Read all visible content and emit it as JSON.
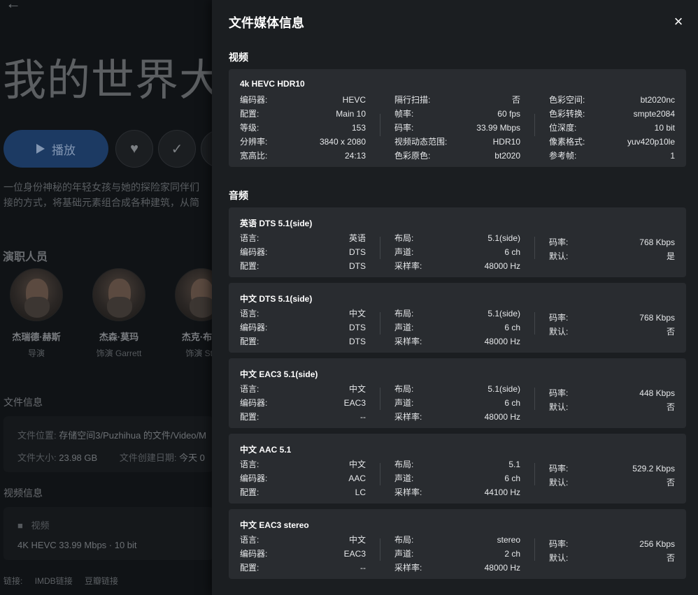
{
  "background": {
    "back_arrow": "←",
    "movie_title": "我的世界大",
    "play_label": "播放",
    "overview_line1": "一位身份神秘的年轻女孩与她的探险家同伴们",
    "overview_line2": "接的方式，将基础元素组合成各种建筑，从简",
    "cast_title": "演职人员",
    "cast": [
      {
        "name": "杰瑞德·赫斯",
        "role": "导演"
      },
      {
        "name": "杰森·莫玛",
        "role": "饰演 Garrett"
      },
      {
        "name": "杰克·布莱",
        "role": "饰演 Ste"
      }
    ],
    "file_info_title": "文件信息",
    "file_location_label": "文件位置:",
    "file_location_value": "存储空间3/Puzhihua 的文件/Video/M",
    "file_size_label": "文件大小:",
    "file_size_value": "23.98 GB",
    "file_created_label": "文件创建日期:",
    "file_created_value": "今天 0",
    "video_info_title": "视频信息",
    "video_label": "视频",
    "video_summary": "4K HEVC 33.99 Mbps · 10 bit",
    "links_label": "链接:",
    "link_imdb": "IMDB链接",
    "link_douban": "豆瓣链接"
  },
  "drawer": {
    "title": "文件媒体信息",
    "close_icon": "×",
    "video_section_title": "视频",
    "video": {
      "title": "4k HEVC HDR10",
      "col1": [
        {
          "k": "编码器:",
          "v": "HEVC"
        },
        {
          "k": "配置:",
          "v": "Main 10"
        },
        {
          "k": "等级:",
          "v": "153"
        },
        {
          "k": "分辨率:",
          "v": "3840 x 2080"
        },
        {
          "k": "宽高比:",
          "v": "24:13"
        }
      ],
      "col2": [
        {
          "k": "隔行扫描:",
          "v": "否"
        },
        {
          "k": "帧率:",
          "v": "60 fps"
        },
        {
          "k": "码率:",
          "v": "33.99 Mbps"
        },
        {
          "k": "视频动态范围:",
          "v": "HDR10"
        },
        {
          "k": "色彩原色:",
          "v": "bt2020"
        }
      ],
      "col3": [
        {
          "k": "色彩空间:",
          "v": "bt2020nc"
        },
        {
          "k": "色彩转换:",
          "v": "smpte2084"
        },
        {
          "k": "位深度:",
          "v": "10 bit"
        },
        {
          "k": "像素格式:",
          "v": "yuv420p10le"
        },
        {
          "k": "参考帧:",
          "v": "1"
        }
      ]
    },
    "audio_section_title": "音频",
    "audio": [
      {
        "title": "英语 DTS 5.1(side)",
        "col1": [
          {
            "k": "语言:",
            "v": "英语"
          },
          {
            "k": "编码器:",
            "v": "DTS"
          },
          {
            "k": "配置:",
            "v": "DTS"
          }
        ],
        "col2": [
          {
            "k": "布局:",
            "v": "5.1(side)"
          },
          {
            "k": "声道:",
            "v": "6 ch"
          },
          {
            "k": "采样率:",
            "v": "48000 Hz"
          }
        ],
        "col3": [
          {
            "k": "码率:",
            "v": "768 Kbps"
          },
          {
            "k": "默认:",
            "v": "是"
          }
        ]
      },
      {
        "title": "中文 DTS 5.1(side)",
        "col1": [
          {
            "k": "语言:",
            "v": "中文"
          },
          {
            "k": "编码器:",
            "v": "DTS"
          },
          {
            "k": "配置:",
            "v": "DTS"
          }
        ],
        "col2": [
          {
            "k": "布局:",
            "v": "5.1(side)"
          },
          {
            "k": "声道:",
            "v": "6 ch"
          },
          {
            "k": "采样率:",
            "v": "48000 Hz"
          }
        ],
        "col3": [
          {
            "k": "码率:",
            "v": "768 Kbps"
          },
          {
            "k": "默认:",
            "v": "否"
          }
        ]
      },
      {
        "title": "中文 EAC3 5.1(side)",
        "col1": [
          {
            "k": "语言:",
            "v": "中文"
          },
          {
            "k": "编码器:",
            "v": "EAC3"
          },
          {
            "k": "配置:",
            "v": "--"
          }
        ],
        "col2": [
          {
            "k": "布局:",
            "v": "5.1(side)"
          },
          {
            "k": "声道:",
            "v": "6 ch"
          },
          {
            "k": "采样率:",
            "v": "48000 Hz"
          }
        ],
        "col3": [
          {
            "k": "码率:",
            "v": "448 Kbps"
          },
          {
            "k": "默认:",
            "v": "否"
          }
        ]
      },
      {
        "title": "中文 AAC 5.1",
        "col1": [
          {
            "k": "语言:",
            "v": "中文"
          },
          {
            "k": "编码器:",
            "v": "AAC"
          },
          {
            "k": "配置:",
            "v": "LC"
          }
        ],
        "col2": [
          {
            "k": "布局:",
            "v": "5.1"
          },
          {
            "k": "声道:",
            "v": "6 ch"
          },
          {
            "k": "采样率:",
            "v": "44100 Hz"
          }
        ],
        "col3": [
          {
            "k": "码率:",
            "v": "529.2 Kbps"
          },
          {
            "k": "默认:",
            "v": "否"
          }
        ]
      },
      {
        "title": "中文 EAC3 stereo",
        "col1": [
          {
            "k": "语言:",
            "v": "中文"
          },
          {
            "k": "编码器:",
            "v": "EAC3"
          },
          {
            "k": "配置:",
            "v": "--"
          }
        ],
        "col2": [
          {
            "k": "布局:",
            "v": "stereo"
          },
          {
            "k": "声道:",
            "v": "2 ch"
          },
          {
            "k": "采样率:",
            "v": "48000 Hz"
          }
        ],
        "col3": [
          {
            "k": "码率:",
            "v": "256 Kbps"
          },
          {
            "k": "默认:",
            "v": "否"
          }
        ]
      }
    ]
  }
}
